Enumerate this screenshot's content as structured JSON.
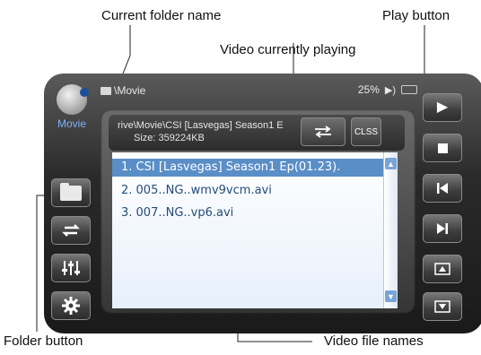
{
  "callouts": {
    "current_folder_name": "Current folder name",
    "play_button": "Play button",
    "video_currently_playing": "Video currently playing",
    "folder_button": "Folder button",
    "video_file_names": "Video file names"
  },
  "status_bar": {
    "path": "\\Movie",
    "volume": "25%"
  },
  "app": {
    "label": "Movie"
  },
  "now_playing": {
    "path": "rive\\Movie\\CSI [Lasvegas] Season1 E",
    "size": "Size: 359224KB",
    "close_label": "CLSS"
  },
  "playlist": {
    "items": [
      {
        "label": "1. CSI [Lasvegas] Season1 Ep(01.23)."
      },
      {
        "label": "2. 005..NG..wmv9vcm.avi"
      },
      {
        "label": "3. 007..NG..vp6.avi"
      }
    ]
  },
  "icons": {
    "left": [
      "folder-icon",
      "repeat-icon",
      "equalizer-icon",
      "gear-icon"
    ],
    "right": [
      "play-icon",
      "stop-icon",
      "previous-icon",
      "next-icon",
      "page-up-icon",
      "page-down-icon"
    ]
  }
}
